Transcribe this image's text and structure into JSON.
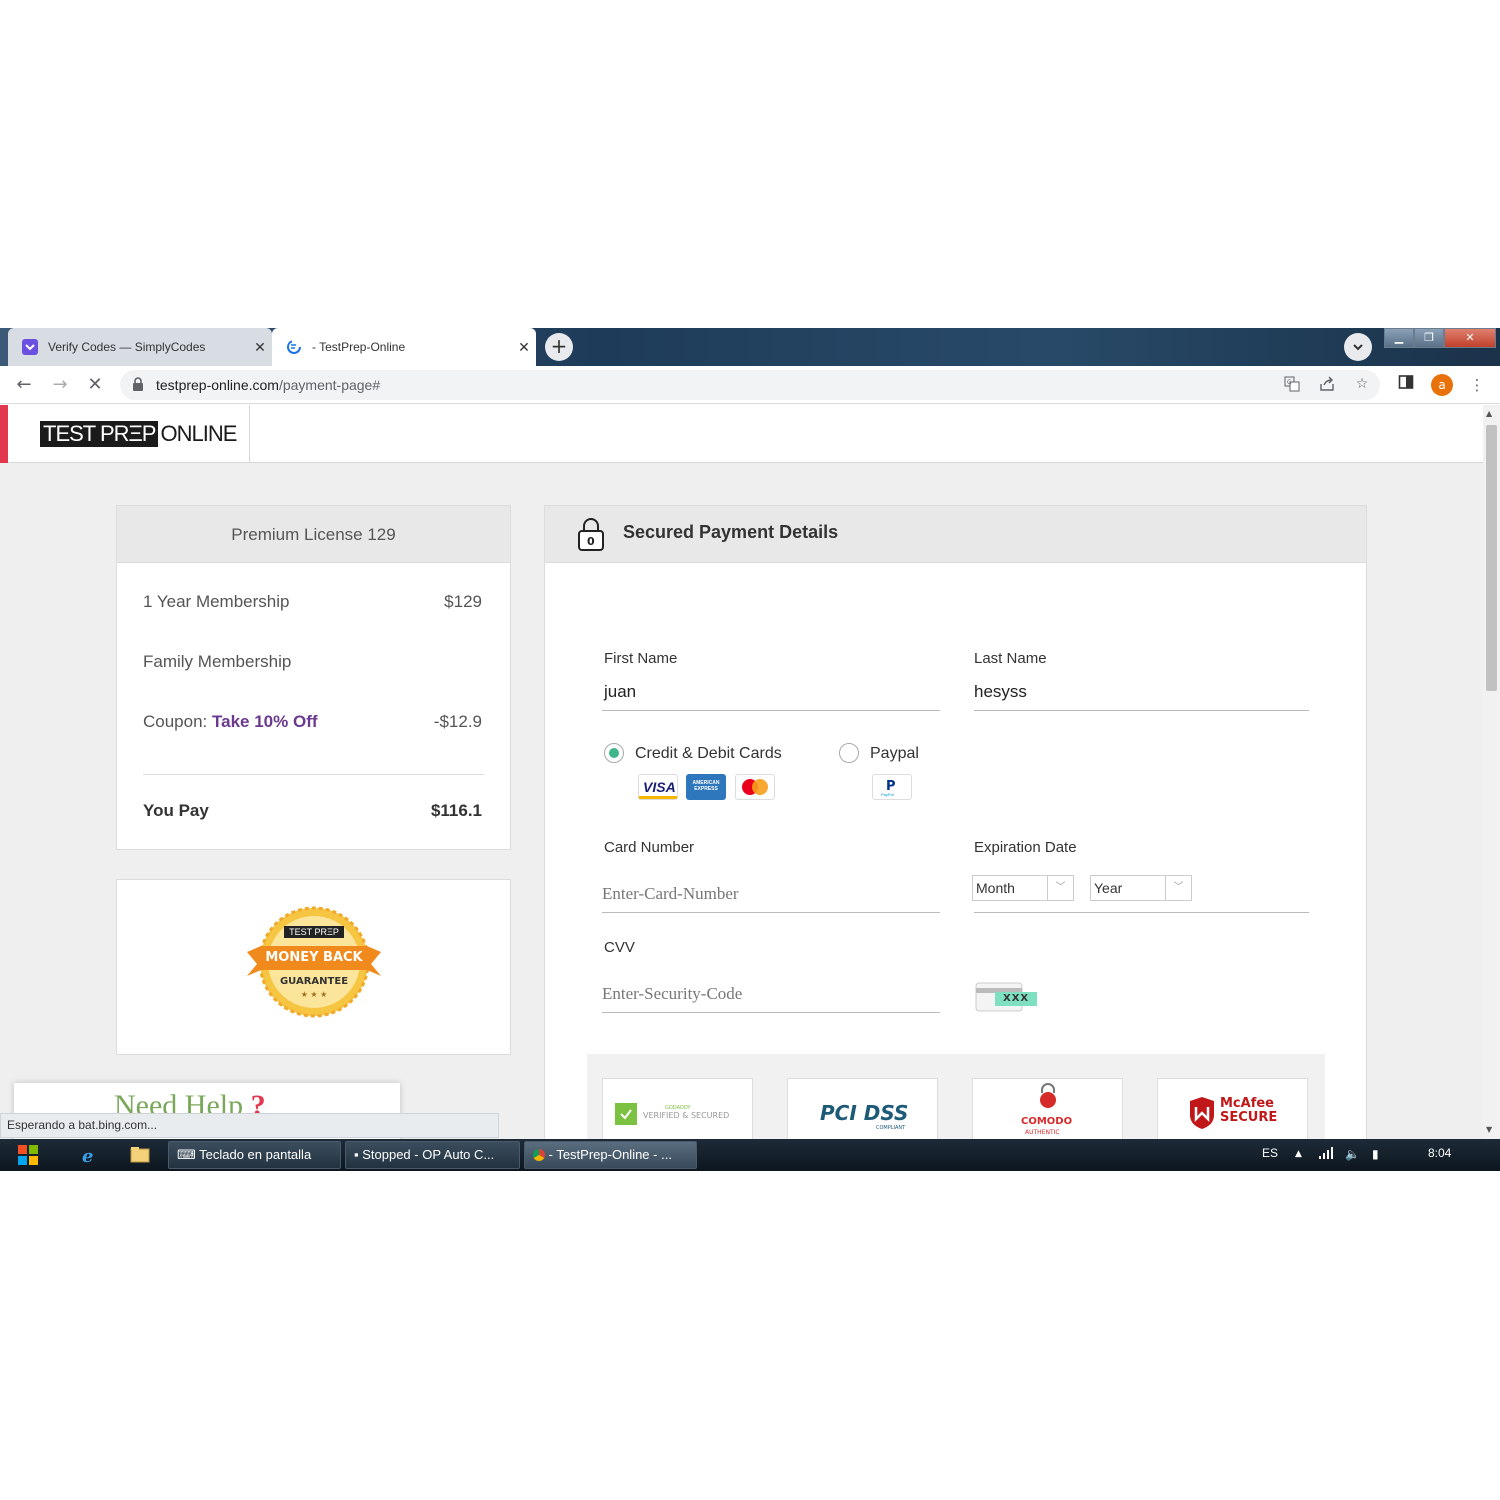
{
  "browser": {
    "tabs": [
      {
        "title": "Verify Codes — SimplyCodes",
        "close": "✕"
      },
      {
        "title": "- TestPrep-Online",
        "close": "✕"
      }
    ],
    "new_tab": "+",
    "url_host": "testprep-online.com",
    "url_path": "/payment-page#",
    "profile_initial": "a"
  },
  "site": {
    "logo_dark": "TEST PRΞP",
    "logo_light": "ONLINE"
  },
  "order": {
    "header": "Premium License 129",
    "rows": [
      {
        "label": "1 Year Membership",
        "value": "$129"
      },
      {
        "label": "Family Membership",
        "value": ""
      },
      {
        "label_prefix": "Coupon:",
        "label_highlight": "Take 10% Off",
        "value": "-$12.9"
      }
    ],
    "total_label": "You Pay",
    "total_value": "$116.1"
  },
  "guarantee": {
    "brand": "TEST PRΞP",
    "line1": "MONEY BACK",
    "line2": "GUARANTEE",
    "stars": "★ ★ ★"
  },
  "help": {
    "text": "Need Help",
    "mark": "?"
  },
  "payment": {
    "title": "Secured Payment Details",
    "lock_digit": "0",
    "first_name_label": "First Name",
    "first_name_value": "juan",
    "last_name_label": "Last Name",
    "last_name_value": "hesyss",
    "method_cards": "Credit & Debit Cards",
    "method_paypal": "Paypal",
    "method_selected": "Credit & Debit Cards",
    "visa": "VISA",
    "amex": "AMERICAN EXPRESS",
    "paypal_small": "PayPal",
    "card_number_label": "Card Number",
    "card_number_placeholder": "Enter-Card-Number",
    "expiration_label": "Expiration Date",
    "month": "Month",
    "year": "Year",
    "cvv_label": "CVV",
    "cvv_placeholder": "Enter-Security-Code",
    "cvv_hint": "XXX",
    "trust_badges": [
      "VERIFIED & SECURED",
      "PCI DSS",
      "COMODO",
      "McAfee SECURE"
    ],
    "trust_small": [
      "GODADDY",
      "COMPLIANT",
      "AUTHENTIC"
    ]
  },
  "status_bar": "Esperando a bat.bing.com...",
  "taskbar": {
    "items": [
      "Teclado en pantalla",
      "Stopped - OP Auto C...",
      "- TestPrep-Online - ..."
    ],
    "lang": "ES",
    "time": "8:04"
  },
  "colors": {
    "accent_red": "#e2384f",
    "coupon_purple": "#6b3a8e",
    "radio_green": "#3fb58a",
    "badge_orange": "#f08a1c"
  }
}
